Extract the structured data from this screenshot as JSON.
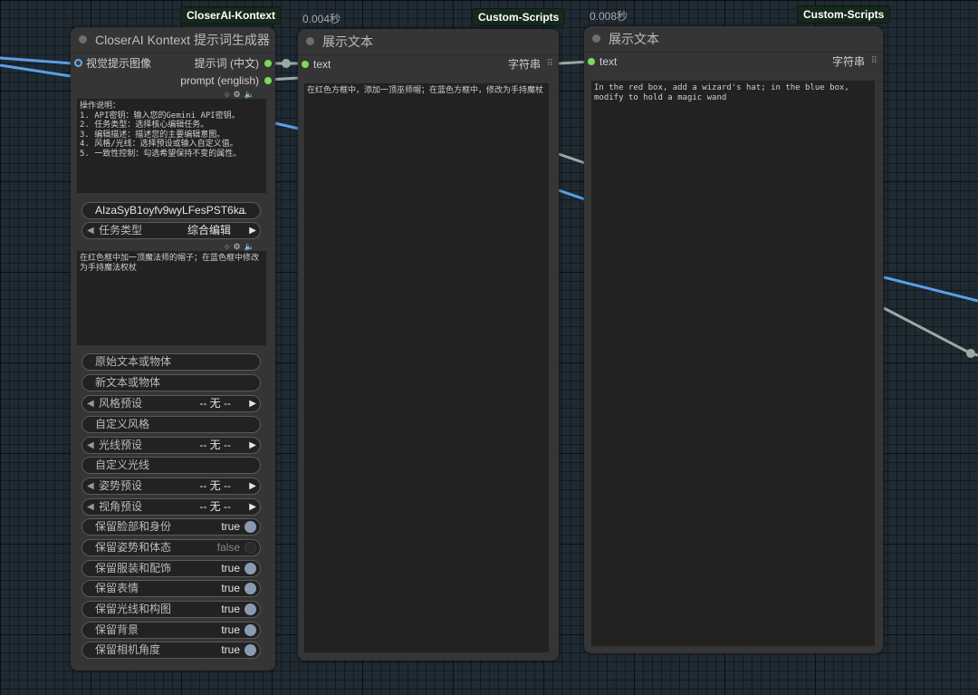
{
  "colors": {
    "accent_green": "#7ed957",
    "link_blue": "#5aa0e6",
    "link_gray": "#9aaaa4"
  },
  "node1": {
    "badge": "CloserAI-Kontext",
    "title": "CloserAI Kontext 提示词生成器",
    "input_label": "视觉提示图像",
    "output1": "提示词 (中文)",
    "output2": "prompt (english)",
    "instructions": "操作说明：\n1. API密钥：输入您的Gemini API密钥。\n2. 任务类型：选择核心编辑任务。\n3. 编辑描述：描述您的主要编辑意图。\n4. 风格/光线：选择预设或输入自定义值。\n5. 一致性控制：勾选希望保持不变的属性。",
    "api_key": "AIzaSyB1oyfv9wyLFesPST6ka",
    "api_key_ellipsis": "...",
    "task_label": "任务类型",
    "task_value": "综合编辑",
    "edit_desc": "在红色框中加一顶魔法师的帽子；在蓝色框中修改为手持魔法权杖",
    "original_text": "原始文本或物体",
    "new_text": "新文本或物体",
    "style_label": "风格预设",
    "style_value": "-- 无 --",
    "custom_style": "自定义风格",
    "light_label": "光线预设",
    "light_value": "-- 无 --",
    "custom_light": "自定义光线",
    "pose_label": "姿势预设",
    "pose_value": "-- 无 --",
    "view_label": "视角预设",
    "view_value": "-- 无 --",
    "toggles": [
      {
        "label": "保留脸部和身份",
        "value": "true"
      },
      {
        "label": "保留姿势和体态",
        "value": "false"
      },
      {
        "label": "保留服装和配饰",
        "value": "true"
      },
      {
        "label": "保留表情",
        "value": "true"
      },
      {
        "label": "保留光线和构图",
        "value": "true"
      },
      {
        "label": "保留背景",
        "value": "true"
      },
      {
        "label": "保留相机角度",
        "value": "true"
      }
    ]
  },
  "node2": {
    "timing": "0.004秒",
    "badge": "Custom-Scripts",
    "title": "展示文本",
    "input_label": "text",
    "output_label": "字符串",
    "text": "在红色方框中，添加一顶巫师帽；在蓝色方框中，修改为手持魔杖"
  },
  "node3": {
    "timing": "0.008秒",
    "badge": "Custom-Scripts",
    "title": "展示文本",
    "input_label": "text",
    "output_label": "字符串",
    "text": "In the red box, add a wizard's hat; in the blue box, modify to hold a magic wand"
  }
}
